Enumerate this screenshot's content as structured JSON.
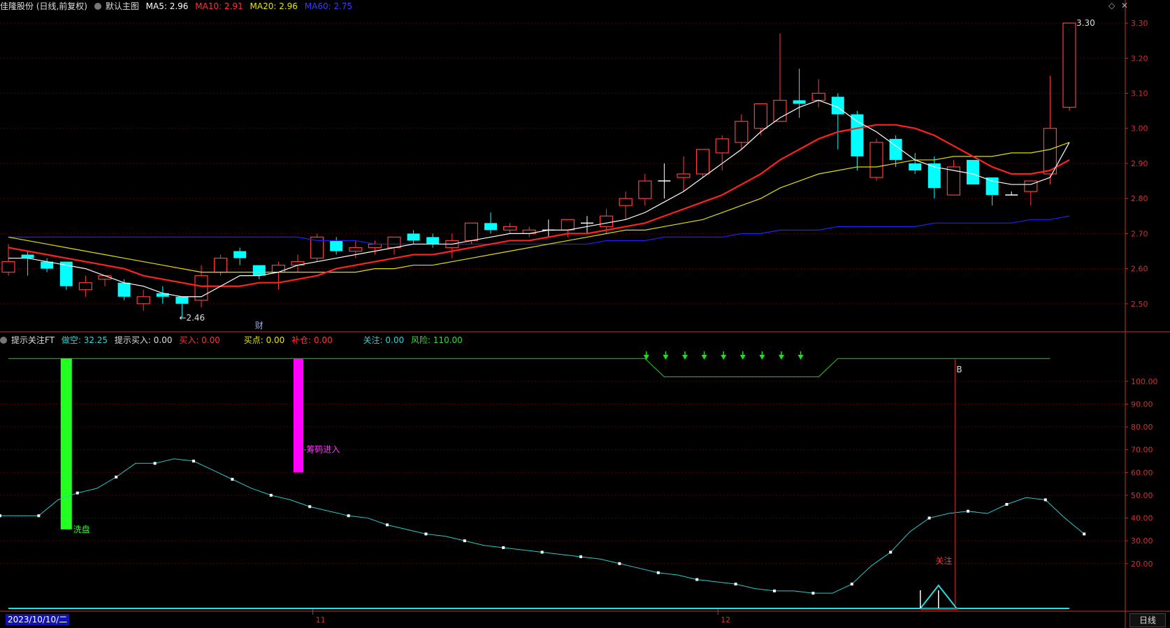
{
  "header_main": {
    "stock": "佳隆股份 (日线,前复权)",
    "template": "默认主图",
    "ma5": "MA5: 2.96",
    "ma10": "MA10: 2.91",
    "ma20": "MA20: 2.96",
    "ma60": "MA60: 2.75"
  },
  "header_indicator": {
    "name": "提示关注FT",
    "zuokong": "做空: 32.25",
    "tishimairu": "提示买入: 0.00",
    "mairu": "买入: 0.00",
    "maidian": "买点: 0.00",
    "bucang": "补仓: 0.00",
    "guanzhu": "关注: 0.00",
    "fengxian": "风险: 110.00"
  },
  "colors": {
    "up": "#ff3b3b",
    "down": "#00ffff",
    "ma5": "#ffffff",
    "ma10": "#ff2020",
    "ma20": "#e0e000",
    "ma60": "#2020ff",
    "grid": "#5a0000",
    "axis": "#c33333"
  },
  "price_axis_labels": [
    "3.30",
    "3.20",
    "3.10",
    "3.00",
    "2.90",
    "2.80",
    "2.70",
    "2.60",
    "2.50"
  ],
  "ind_axis_labels": [
    "100.00",
    "90.00",
    "80.00",
    "70.00",
    "60.00",
    "50.00",
    "40.00",
    "30.00",
    "20.00"
  ],
  "date_labels": [
    "11",
    "12"
  ],
  "bottom": {
    "date": "2023/10/10/二",
    "period": "日线"
  },
  "annotations": {
    "low": "←2.46",
    "high": "3.30",
    "cai": "财",
    "xipan": "洗盘",
    "choumajinru": "筹码进入",
    "guanzhu": "关注",
    "b": "B"
  },
  "chart_data": {
    "type": "candlestick",
    "candles": [
      [
        2.59,
        2.62,
        2.67,
        2.58
      ],
      [
        2.64,
        2.63,
        2.65,
        2.58
      ],
      [
        2.62,
        2.6,
        2.63,
        2.59
      ],
      [
        2.62,
        2.55,
        2.62,
        2.54
      ],
      [
        2.54,
        2.56,
        2.58,
        2.52
      ],
      [
        2.57,
        2.58,
        2.58,
        2.55
      ],
      [
        2.56,
        2.52,
        2.57,
        2.51
      ],
      [
        2.5,
        2.52,
        2.54,
        2.48
      ],
      [
        2.53,
        2.52,
        2.55,
        2.5
      ],
      [
        2.52,
        2.5,
        2.52,
        2.46
      ],
      [
        2.51,
        2.58,
        2.61,
        2.49
      ],
      [
        2.59,
        2.63,
        2.64,
        2.58
      ],
      [
        2.65,
        2.63,
        2.66,
        2.61
      ],
      [
        2.61,
        2.58,
        2.61,
        2.57
      ],
      [
        2.59,
        2.61,
        2.62,
        2.54
      ],
      [
        2.61,
        2.62,
        2.64,
        2.59
      ],
      [
        2.63,
        2.69,
        2.7,
        2.62
      ],
      [
        2.68,
        2.65,
        2.69,
        2.64
      ],
      [
        2.65,
        2.66,
        2.68,
        2.63
      ],
      [
        2.66,
        2.67,
        2.68,
        2.64
      ],
      [
        2.66,
        2.69,
        2.69,
        2.64
      ],
      [
        2.7,
        2.68,
        2.71,
        2.67
      ],
      [
        2.69,
        2.67,
        2.7,
        2.66
      ],
      [
        2.66,
        2.68,
        2.7,
        2.63
      ],
      [
        2.68,
        2.73,
        2.73,
        2.67
      ],
      [
        2.73,
        2.71,
        2.76,
        2.7
      ],
      [
        2.71,
        2.72,
        2.73,
        2.7
      ],
      [
        2.7,
        2.71,
        2.72,
        2.69
      ],
      [
        2.71,
        2.71,
        2.74,
        2.69
      ],
      [
        2.71,
        2.74,
        2.74,
        2.69
      ],
      [
        2.73,
        2.73,
        2.75,
        2.7
      ],
      [
        2.72,
        2.75,
        2.77,
        2.7
      ],
      [
        2.78,
        2.8,
        2.82,
        2.74
      ],
      [
        2.8,
        2.85,
        2.87,
        2.78
      ],
      [
        2.85,
        2.85,
        2.9,
        2.8
      ],
      [
        2.86,
        2.87,
        2.92,
        2.82
      ],
      [
        2.87,
        2.94,
        2.94,
        2.86
      ],
      [
        2.93,
        2.97,
        2.98,
        2.88
      ],
      [
        2.96,
        3.02,
        3.04,
        2.94
      ],
      [
        3.0,
        3.07,
        3.07,
        2.98
      ],
      [
        3.02,
        3.08,
        3.27,
        3.02
      ],
      [
        3.08,
        3.07,
        3.17,
        3.03
      ],
      [
        3.08,
        3.1,
        3.14,
        3.06
      ],
      [
        3.09,
        3.04,
        3.1,
        2.94
      ],
      [
        3.04,
        2.92,
        3.05,
        2.88
      ],
      [
        2.86,
        2.96,
        2.97,
        2.85
      ],
      [
        2.97,
        2.91,
        2.98,
        2.89
      ],
      [
        2.9,
        2.88,
        2.93,
        2.87
      ],
      [
        2.9,
        2.83,
        2.92,
        2.8
      ],
      [
        2.81,
        2.89,
        2.91,
        2.81
      ],
      [
        2.91,
        2.84,
        2.91,
        2.84
      ],
      [
        2.86,
        2.81,
        2.86,
        2.78
      ],
      [
        2.81,
        2.81,
        2.82,
        2.81
      ],
      [
        2.82,
        2.85,
        2.85,
        2.78
      ],
      [
        2.87,
        3.0,
        3.15,
        2.84
      ],
      [
        3.06,
        3.3,
        3.3,
        3.05
      ]
    ],
    "ma5": [
      2.63,
      2.63,
      2.62,
      2.61,
      2.6,
      2.58,
      2.56,
      2.55,
      2.53,
      2.52,
      2.52,
      2.55,
      2.58,
      2.58,
      2.59,
      2.61,
      2.62,
      2.63,
      2.64,
      2.65,
      2.66,
      2.67,
      2.67,
      2.67,
      2.68,
      2.69,
      2.7,
      2.7,
      2.71,
      2.71,
      2.72,
      2.73,
      2.74,
      2.76,
      2.79,
      2.82,
      2.86,
      2.9,
      2.94,
      2.99,
      3.03,
      3.06,
      3.08,
      3.06,
      3.02,
      2.99,
      2.95,
      2.91,
      2.89,
      2.88,
      2.87,
      2.85,
      2.84,
      2.84,
      2.86,
      2.96
    ],
    "ma10": [
      2.66,
      2.65,
      2.64,
      2.63,
      2.62,
      2.61,
      2.6,
      2.58,
      2.57,
      2.56,
      2.55,
      2.55,
      2.55,
      2.56,
      2.56,
      2.57,
      2.58,
      2.6,
      2.61,
      2.62,
      2.63,
      2.64,
      2.64,
      2.65,
      2.66,
      2.67,
      2.68,
      2.68,
      2.69,
      2.7,
      2.7,
      2.71,
      2.72,
      2.73,
      2.75,
      2.77,
      2.79,
      2.81,
      2.84,
      2.87,
      2.91,
      2.94,
      2.97,
      2.99,
      3.0,
      3.01,
      3.01,
      3.0,
      2.98,
      2.95,
      2.92,
      2.89,
      2.87,
      2.87,
      2.88,
      2.91
    ],
    "ma20": [
      2.69,
      2.68,
      2.67,
      2.66,
      2.65,
      2.64,
      2.63,
      2.62,
      2.61,
      2.6,
      2.59,
      2.59,
      2.59,
      2.59,
      2.59,
      2.59,
      2.59,
      2.59,
      2.59,
      2.6,
      2.6,
      2.61,
      2.61,
      2.62,
      2.63,
      2.64,
      2.65,
      2.66,
      2.67,
      2.68,
      2.69,
      2.7,
      2.71,
      2.71,
      2.72,
      2.73,
      2.74,
      2.76,
      2.78,
      2.8,
      2.83,
      2.85,
      2.87,
      2.88,
      2.89,
      2.89,
      2.9,
      2.91,
      2.91,
      2.92,
      2.92,
      2.92,
      2.93,
      2.93,
      2.94,
      2.96
    ],
    "ma60": [
      2.69,
      2.69,
      2.69,
      2.69,
      2.69,
      2.69,
      2.69,
      2.69,
      2.69,
      2.69,
      2.69,
      2.69,
      2.69,
      2.69,
      2.69,
      2.69,
      2.68,
      2.68,
      2.68,
      2.67,
      2.67,
      2.67,
      2.67,
      2.67,
      2.67,
      2.67,
      2.67,
      2.67,
      2.67,
      2.67,
      2.67,
      2.68,
      2.68,
      2.68,
      2.69,
      2.69,
      2.69,
      2.69,
      2.7,
      2.7,
      2.71,
      2.71,
      2.71,
      2.72,
      2.72,
      2.72,
      2.72,
      2.72,
      2.73,
      2.73,
      2.73,
      2.73,
      2.73,
      2.74,
      2.74,
      2.75
    ],
    "indicator_line": [
      41,
      41,
      41,
      48,
      51,
      53,
      58,
      64,
      64,
      66,
      65,
      61,
      57,
      53,
      50,
      48,
      45,
      43,
      41,
      40,
      37,
      35,
      33,
      32,
      30,
      28,
      27,
      26,
      25,
      24,
      23,
      22,
      20,
      18,
      16,
      15,
      13,
      12,
      11,
      9,
      8,
      8,
      7,
      7,
      11,
      19,
      25,
      34,
      40,
      42,
      43,
      42,
      46,
      49,
      48,
      40,
      33
    ],
    "ind_top_line": [
      110,
      110,
      110,
      110,
      110,
      110,
      110,
      110,
      110,
      110,
      110,
      110,
      110,
      110,
      110,
      110,
      110,
      110,
      110,
      110,
      110,
      110,
      110,
      110,
      110,
      110,
      110,
      110,
      110,
      110,
      110,
      110,
      110,
      110,
      102,
      102,
      102,
      102,
      102,
      102,
      102,
      102,
      102,
      110,
      110,
      110,
      110,
      110,
      110,
      110,
      110,
      110,
      110,
      110,
      110
    ],
    "price_range": [
      2.42,
      3.33
    ],
    "ind_range": [
      0,
      115
    ]
  }
}
